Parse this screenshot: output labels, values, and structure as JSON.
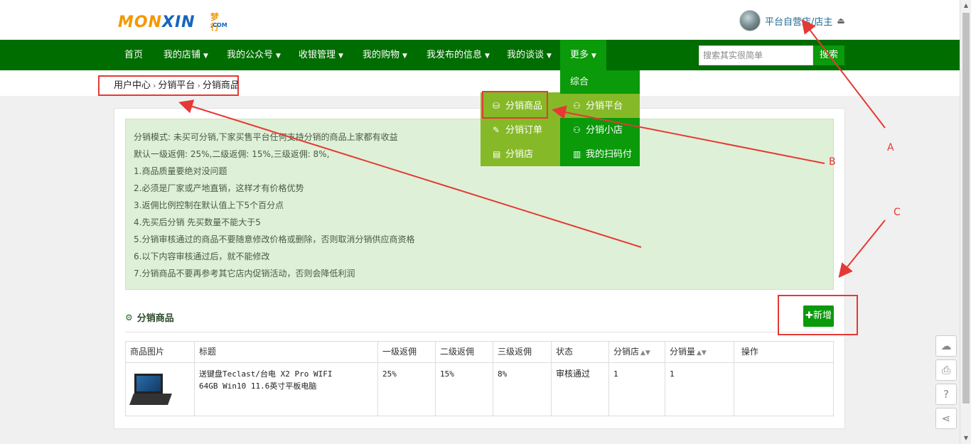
{
  "logo": {
    "text_orange": "MON",
    "text_blue": "XIN",
    "side_cn": "梦行",
    "side_com": ".COM"
  },
  "user": {
    "name": "平台自营店/店主"
  },
  "nav": {
    "items": [
      {
        "label": "首页"
      },
      {
        "label": "我的店铺"
      },
      {
        "label": "我的公众号"
      },
      {
        "label": "收银管理"
      },
      {
        "label": "我的购物"
      },
      {
        "label": "我发布的信息"
      },
      {
        "label": "我的谈谈"
      },
      {
        "label": "更多"
      }
    ],
    "search_placeholder": "搜索其实很简单",
    "search_button": "搜索"
  },
  "breadcrumb": {
    "items": [
      "用户中心",
      "分销平台",
      "分销商品"
    ]
  },
  "dropdown": {
    "left": [
      "分销商品",
      "分销订单",
      "分销店"
    ],
    "right": [
      "综合",
      "分销平台",
      "分销小店",
      "我的扫码付"
    ]
  },
  "notice": {
    "lines": [
      "分销模式: 未买可分销,下家买售平台任何支持分销的商品上家都有收益",
      "默认一级返佣: 25%,二级返佣: 15%,三级返佣: 8%,",
      "1.商品质量要绝对没问题",
      "2.必须是厂家或产地直销，这样才有价格优势",
      "3.返佣比例控制在默认值上下5个百分点",
      "4.先买后分销 先买数量不能大于5",
      "5.分销审核通过的商品不要随意修改价格或删除，否则取消分销供应商资格",
      "6.以下内容审核通过后，就不能修改",
      "7.分销商品不要再参考其它店内促销活动，否则会降低利润"
    ]
  },
  "section": {
    "title": "分销商品",
    "add_button": "新增"
  },
  "table": {
    "headers": [
      "商品图片",
      "标题",
      "一级返佣",
      "二级返佣",
      "三级返佣",
      "状态",
      "分销店",
      "分销量",
      "操作"
    ],
    "rows": [
      {
        "title_line1": "送键盘Teclast/台电 X2 Pro WIFI",
        "title_line2": "64GB Win10 11.6英寸平板电脑",
        "level1": "25%",
        "level2": "15%",
        "level3": "8%",
        "status": "审核通过",
        "stores": "1",
        "sales": "1",
        "action": ""
      }
    ]
  },
  "annotations": {
    "a": "A",
    "b": "B",
    "c": "C"
  },
  "colors": {
    "nav_bg": "#006d00",
    "accent_green": "#0a9a0a",
    "dropdown_light": "#86b928",
    "annotation_red": "#e53935",
    "notice_bg": "#dff0d8"
  }
}
